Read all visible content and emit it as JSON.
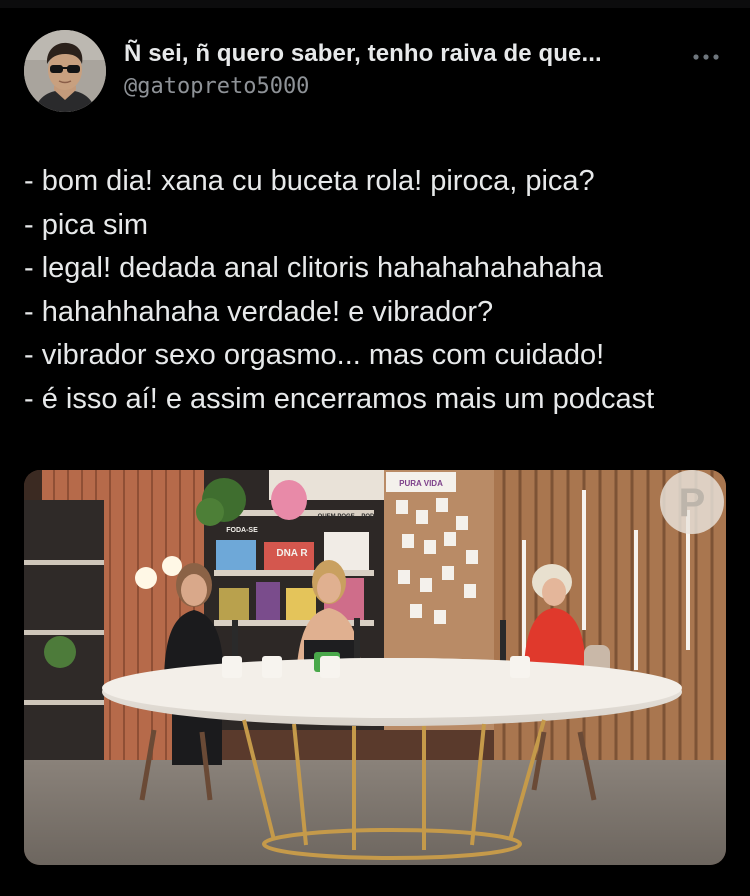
{
  "author": {
    "display_name": "Ñ sei, ñ quero saber, tenho raiva de que...",
    "handle": "@gatopreto5000",
    "avatar_icon": "profile-photo-man-sunglasses"
  },
  "more_icon": "more-horizontal-icon",
  "tweet": {
    "lines": [
      "- bom dia! xana cu buceta rola! piroca, pica?",
      "- pica sim",
      "- legal! dedada anal clitoris hahahahahahaha",
      "- hahahhahaha verdade! e vibrador?",
      "- vibrador sexo orgasmo... mas com cuidado!",
      "- é isso aí! e assim encerramos mais um podcast"
    ]
  },
  "media": {
    "description_icon": "podcast-studio-photo",
    "watermark_logo": "P",
    "set_signs": {
      "sign_left": "FODA-SE",
      "sign_mug": "QUEM POGE... POD",
      "sign_top": "PURA VIDA",
      "sign_name": "DNA R"
    }
  },
  "colors": {
    "background": "#000000",
    "text_primary": "#e7e9ea",
    "text_secondary": "#8e9297"
  }
}
